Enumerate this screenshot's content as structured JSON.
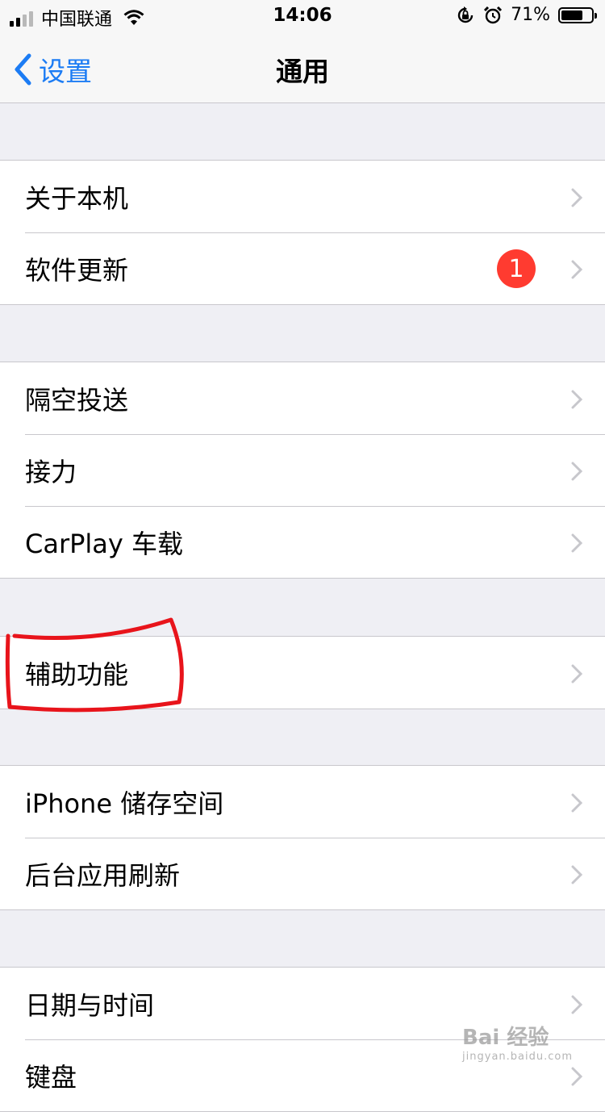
{
  "status_bar": {
    "carrier": "中国联通",
    "time": "14:06",
    "battery_percent": "71%",
    "battery_level": 0.71,
    "icons": [
      "signal-icon",
      "wifi-icon",
      "orientation-lock-icon",
      "alarm-icon",
      "battery-icon"
    ]
  },
  "nav": {
    "back_label": "设置",
    "title": "通用"
  },
  "groups": [
    {
      "items": [
        {
          "label": "关于本机"
        },
        {
          "label": "软件更新",
          "badge": "1"
        }
      ]
    },
    {
      "items": [
        {
          "label": "隔空投送"
        },
        {
          "label": "接力"
        },
        {
          "label": "CarPlay 车载"
        }
      ]
    },
    {
      "items": [
        {
          "label": "辅助功能"
        }
      ]
    },
    {
      "items": [
        {
          "label": "iPhone 储存空间"
        },
        {
          "label": "后台应用刷新"
        }
      ]
    },
    {
      "items": [
        {
          "label": "日期与时间"
        },
        {
          "label": "键盘"
        }
      ]
    }
  ],
  "watermark": {
    "text": "Bai 经验",
    "sub": "jingyan.baidu.com"
  },
  "colors": {
    "accent": "#1c7cf4",
    "badge": "#ff3b30",
    "annotation": "#e8141b",
    "background": "#efeff4"
  }
}
